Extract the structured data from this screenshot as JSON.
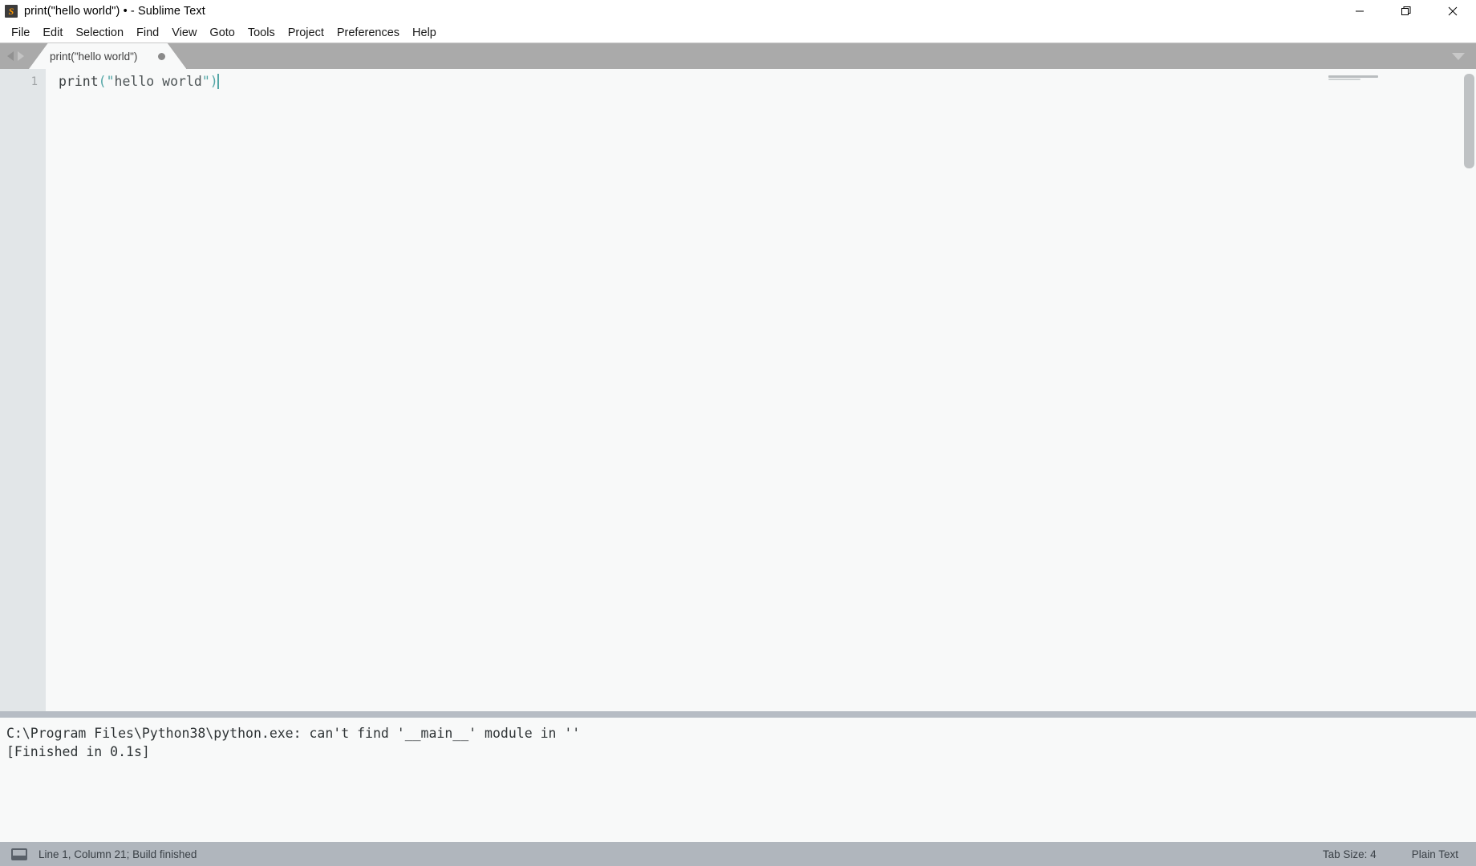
{
  "window": {
    "title": "print(\"hello world\") • - Sublime Text",
    "logo_icon": "sublime-text-logo",
    "logo_glyph": "S",
    "controls": {
      "minimize": "minimize-icon",
      "restore": "restore-icon",
      "close": "close-icon"
    }
  },
  "menubar": {
    "items": [
      {
        "label": "File"
      },
      {
        "label": "Edit"
      },
      {
        "label": "Selection"
      },
      {
        "label": "Find"
      },
      {
        "label": "View"
      },
      {
        "label": "Goto"
      },
      {
        "label": "Tools"
      },
      {
        "label": "Project"
      },
      {
        "label": "Preferences"
      },
      {
        "label": "Help"
      }
    ]
  },
  "tabbar": {
    "nav_prev_icon": "arrow-left-icon",
    "nav_next_icon": "arrow-right-icon",
    "menu_icon": "chevron-down-icon",
    "tabs": [
      {
        "label": "print(\"hello world\")",
        "dirty": true,
        "dirty_icon": "unsaved-dot-icon",
        "active": true
      }
    ]
  },
  "editor": {
    "gutter": {
      "line_numbers": [
        "1"
      ]
    },
    "lines": [
      {
        "tokens": [
          {
            "type": "name",
            "text": "print"
          },
          {
            "type": "punct",
            "text": "(\""
          },
          {
            "type": "str",
            "text": "hello world"
          },
          {
            "type": "punct",
            "text": "\")"
          }
        ]
      }
    ],
    "caret_visible": true,
    "minimap_visible": true,
    "scrollbar_visible": true
  },
  "console": {
    "lines": [
      "C:\\Program Files\\Python38\\python.exe: can't find '__main__' module in ''",
      "[Finished in 0.1s]"
    ]
  },
  "statusbar": {
    "console_toggle_icon": "console-panel-icon",
    "message": "Line 1, Column 21; Build finished",
    "tab_size": "Tab Size: 4",
    "syntax": "Plain Text"
  },
  "colors": {
    "titlebar_bg": "#ffffff",
    "menubar_bg": "#ffffff",
    "tabbar_bg": "#aaaaaa",
    "tab_active_bg": "#f8f9f9",
    "editor_bg": "#f8f9f9",
    "gutter_bg": "#e2e6e8",
    "console_divider": "#b6bcc4",
    "statusbar_bg": "#b0b6bd",
    "accent_teal": "#53a6a6",
    "logo_orange": "#ff9800"
  }
}
